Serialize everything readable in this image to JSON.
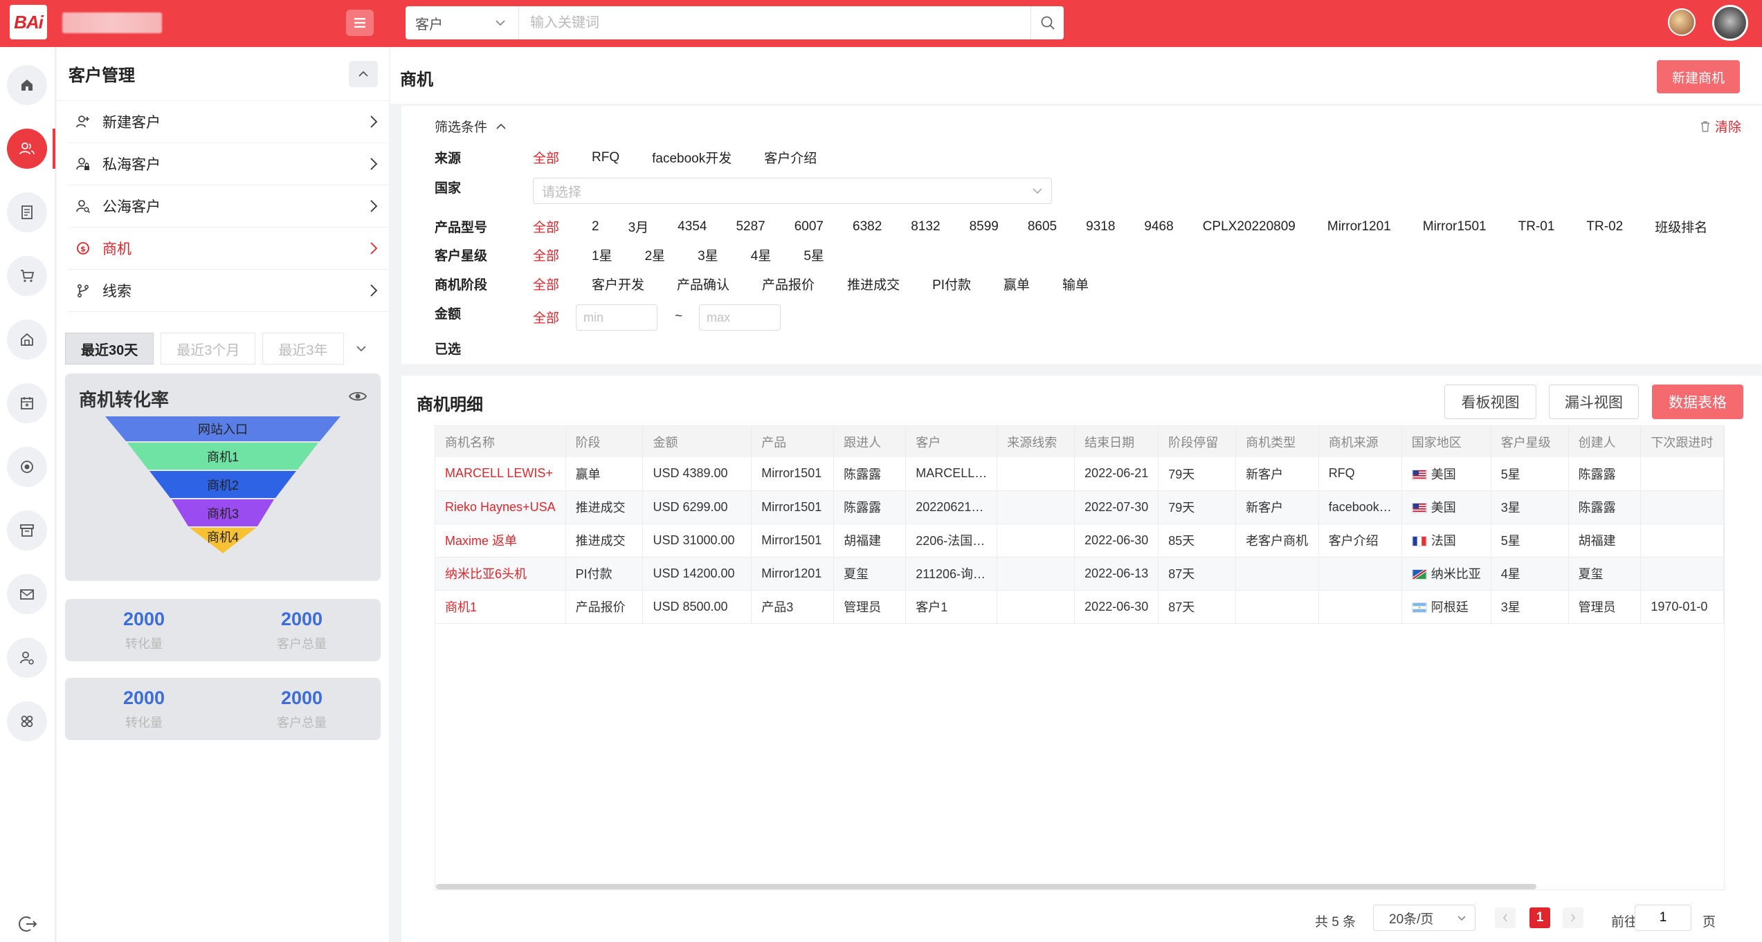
{
  "topbar": {
    "logo": "BAi",
    "search_type": "客户",
    "search_placeholder": "输入关键词"
  },
  "left_panel": {
    "title": "客户管理",
    "nav": [
      {
        "label": "新建客户",
        "icon": "user-plus-icon"
      },
      {
        "label": "私海客户",
        "icon": "user-lock-icon"
      },
      {
        "label": "公海客户",
        "icon": "user-search-icon"
      },
      {
        "label": "商机",
        "icon": "dollar-circle-icon",
        "active": true
      },
      {
        "label": "线索",
        "icon": "branch-icon"
      }
    ],
    "periods": [
      "最近30天",
      "最近3个月",
      "最近3年"
    ],
    "active_period": 0,
    "funnel": {
      "title": "商机转化率",
      "stages": [
        {
          "label": "网站入口",
          "color": "#5a7ee8"
        },
        {
          "label": "商机1",
          "color": "#6ee3a4"
        },
        {
          "label": "商机2",
          "color": "#2f63e6"
        },
        {
          "label": "商机3",
          "color": "#9b4cf0"
        },
        {
          "label": "商机4",
          "color": "#f6c233"
        }
      ]
    },
    "stats": [
      {
        "a_value": "2000",
        "a_label": "转化量",
        "b_value": "2000",
        "b_label": "客户总量"
      },
      {
        "a_value": "2000",
        "a_label": "转化量",
        "b_value": "2000",
        "b_label": "客户总量"
      }
    ]
  },
  "main": {
    "title": "商机",
    "new_button": "新建商机"
  },
  "filter": {
    "toggle_label": "筛选条件",
    "clear_label": "清除",
    "source": {
      "label": "来源",
      "options": [
        "全部",
        "RFQ",
        "facebook开发",
        "客户介绍"
      ]
    },
    "country": {
      "label": "国家",
      "placeholder": "请选择"
    },
    "product": {
      "label": "产品型号",
      "options": [
        "全部",
        "2",
        "3月",
        "4354",
        "5287",
        "6007",
        "6382",
        "8132",
        "8599",
        "8605",
        "9318",
        "9468",
        "CPLX20220809",
        "Mirror1201",
        "Mirror1501",
        "TR-01",
        "TR-02",
        "班级排名"
      ]
    },
    "star": {
      "label": "客户星级",
      "options": [
        "全部",
        "1星",
        "2星",
        "3星",
        "4星",
        "5星"
      ]
    },
    "stage": {
      "label": "商机阶段",
      "options": [
        "全部",
        "客户开发",
        "产品确认",
        "产品报价",
        "推进成交",
        "PI付款",
        "赢单",
        "输单"
      ]
    },
    "amount": {
      "label": "金额",
      "all": "全部",
      "min_placeholder": "min",
      "max_placeholder": "max",
      "sep": "~"
    },
    "selected_label": "已选"
  },
  "detail": {
    "title": "商机明细",
    "views": [
      "看板视图",
      "漏斗视图",
      "数据表格"
    ],
    "active_view": 2,
    "columns": [
      "商机名称",
      "阶段",
      "金额",
      "产品",
      "跟进人",
      "客户",
      "来源线索",
      "结束日期",
      "阶段停留",
      "商机类型",
      "商机来源",
      "国家地区",
      "客户星级",
      "创建人",
      "下次跟进时"
    ],
    "rows": [
      {
        "name": "MARCELL LEWIS+",
        "stage": "赢单",
        "amount": "USD 4389.00",
        "product": "Mirror1501",
        "owner": "陈露露",
        "customer": "MARCELL…",
        "lead": "",
        "end": "2022-06-21",
        "stay": "79天",
        "type": "新客户",
        "src": "RFQ",
        "country": "美国",
        "flag": "us",
        "star": "5星",
        "creator": "陈露露",
        "next": ""
      },
      {
        "name": "Rieko Haynes+USA",
        "stage": "推进成交",
        "amount": "USD 6299.00",
        "product": "Mirror1501",
        "owner": "陈露露",
        "customer": "20220621…",
        "lead": "",
        "end": "2022-07-30",
        "stay": "79天",
        "type": "新客户",
        "src": "facebook…",
        "country": "美国",
        "flag": "us",
        "star": "3星",
        "creator": "陈露露",
        "next": ""
      },
      {
        "name": "Maxime 返单",
        "stage": "推进成交",
        "amount": "USD 31000.00",
        "product": "Mirror1501",
        "owner": "胡福建",
        "customer": "2206-法国…",
        "lead": "",
        "end": "2022-06-30",
        "stay": "85天",
        "type": "老客户商机",
        "src": "客户介绍",
        "country": "法国",
        "flag": "fr",
        "star": "5星",
        "creator": "胡福建",
        "next": ""
      },
      {
        "name": "纳米比亚6头机",
        "stage": "PI付款",
        "amount": "USD 14200.00",
        "product": "Mirror1201",
        "owner": "夏玺",
        "customer": "211206-询…",
        "lead": "",
        "end": "2022-06-13",
        "stay": "87天",
        "type": "",
        "src": "",
        "country": "纳米比亚",
        "flag": "na",
        "star": "4星",
        "creator": "夏玺",
        "next": ""
      },
      {
        "name": "商机1",
        "stage": "产品报价",
        "amount": "USD 8500.00",
        "product": "产品3",
        "owner": "管理员",
        "customer": "客户1",
        "lead": "",
        "end": "2022-06-30",
        "stay": "87天",
        "type": "",
        "src": "",
        "country": "阿根廷",
        "flag": "ar",
        "star": "3星",
        "creator": "管理员",
        "next": "1970-01-0"
      }
    ]
  },
  "pager": {
    "total": "共 5 条",
    "page_size": "20条/页",
    "current": "1",
    "goto_label": "前往",
    "goto_value": "1",
    "page_suffix": "页"
  }
}
